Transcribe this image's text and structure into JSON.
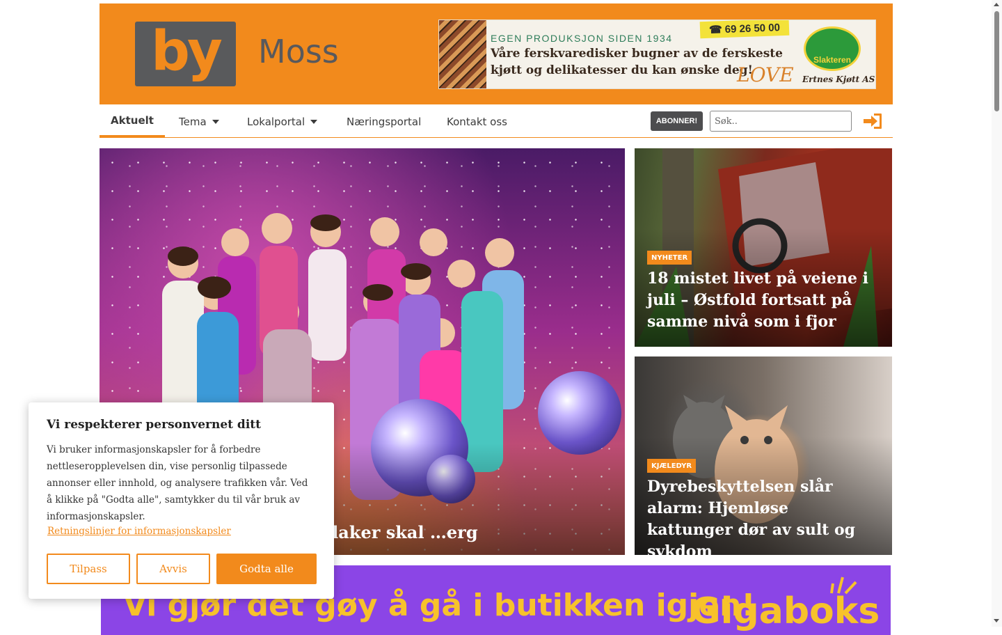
{
  "header": {
    "logo_text": "by",
    "city": "Moss",
    "ad": {
      "line1": "EGEN PRODUKSJON SIDEN 1934",
      "line2": "Våre ferskvaredisker bugner av de ferskeste",
      "line3": "kjøtt og delikatesser du kan ønske deg!",
      "love": "LOVE",
      "phone": "69 26 50 00",
      "seal": "Slakteren",
      "company": "Ertnes Kjøtt AS"
    }
  },
  "nav": {
    "items": [
      {
        "label": "Aktuelt"
      },
      {
        "label": "Tema"
      },
      {
        "label": "Lokalportal"
      },
      {
        "label": "Næringsportal"
      },
      {
        "label": "Kontakt oss"
      }
    ],
    "subscribe_label": "ABONNER!",
    "search_placeholder": "Søk..",
    "icons": {
      "login": "sign-in-icon"
    }
  },
  "articles": {
    "main": {
      "title": "…esong: Marianne Sandaker skal …erg"
    },
    "side": [
      {
        "badge": "NYHETER",
        "title": "18 mistet livet på veiene i juli – Østfold fortsatt på samme nivå som i fjor"
      },
      {
        "badge": "KJÆLEDYR",
        "title": "Dyrebeskyttelsen slår alarm: Hjemløse kattunger dør av sult og sykdom"
      }
    ]
  },
  "bottom_ad": {
    "text": "Vi gjør det gøy å gå i butikken igjen!",
    "brand": "Gigaboks"
  },
  "cookie": {
    "title": "Vi respekterer personvernet ditt",
    "text": "Vi bruker informasjonskapsler for å forbedre nettleseropplevelsen din, vise personlig tilpassede annonser eller innhold, og analysere trafikken vår. Ved å klikke på \"Godta alle\", samtykker du til vår bruk av informasjonskapsler.",
    "link": "Retningslinjer for informasjonskapsler",
    "buttons": {
      "customize": "Tilpass",
      "reject": "Avvis",
      "accept": "Godta alle"
    }
  },
  "colors": {
    "accent": "#f28a1c",
    "dark": "#4d4d4f",
    "ad_purple": "#8b45e6",
    "ad_yellow": "#f7c22b"
  }
}
